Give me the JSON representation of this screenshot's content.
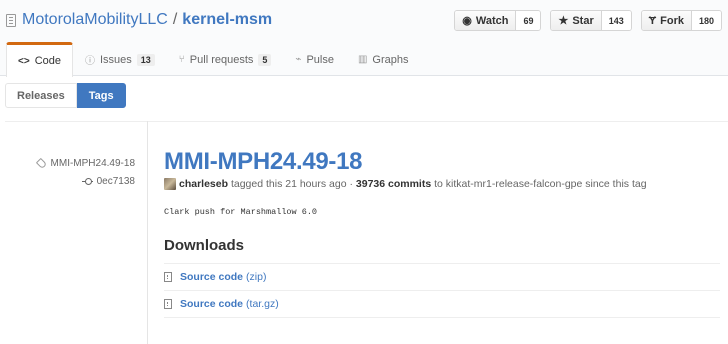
{
  "repo": {
    "owner": "MotorolaMobilityLLC",
    "separator": "/",
    "name": "kernel-msm"
  },
  "actions": {
    "watch": {
      "label": "Watch",
      "count": "69",
      "icon": "eye-icon"
    },
    "star": {
      "label": "Star",
      "count": "143",
      "icon": "star-icon"
    },
    "fork": {
      "label": "Fork",
      "count": "180",
      "icon": "fork-icon"
    }
  },
  "tabs": [
    {
      "label": "Code",
      "icon": "code-icon",
      "selected": true
    },
    {
      "label": "Issues",
      "counter": "13",
      "icon": "issue-icon"
    },
    {
      "label": "Pull requests",
      "counter": "5",
      "icon": "pull-request-icon"
    },
    {
      "label": "Pulse",
      "icon": "pulse-icon"
    },
    {
      "label": "Graphs",
      "icon": "graph-icon"
    }
  ],
  "subnav": {
    "releases": "Releases",
    "tags": "Tags"
  },
  "release": {
    "tag": "MMI-MPH24.49-18",
    "commit": "0ec7138",
    "title": "MMI-MPH24.49-18",
    "author": "charleseb",
    "tagged_text": "tagged this 21 hours ago ·",
    "commits": "39736 commits",
    "to_text": "to kitkat-mr1-release-falcon-gpe since this tag",
    "notes": "Clark push for Marshmallow 6.0",
    "downloads_heading": "Downloads",
    "downloads": [
      {
        "label": "Source code",
        "ext": "(zip)"
      },
      {
        "label": "Source code",
        "ext": "(tar.gz)"
      }
    ]
  }
}
